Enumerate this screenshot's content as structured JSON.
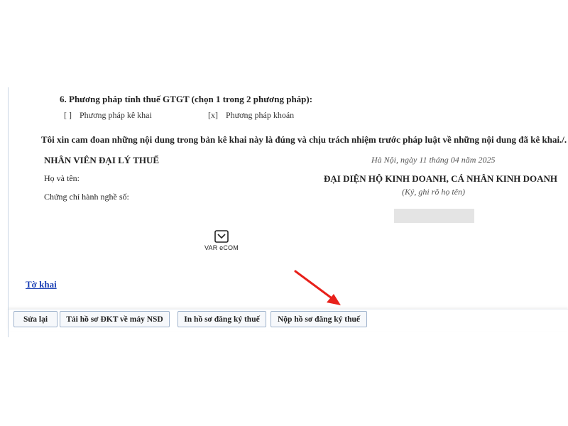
{
  "section": {
    "title": "6. Phương pháp tính thuế GTGT (chọn 1 trong 2 phương pháp):",
    "options": [
      {
        "mark": "[ ]",
        "label": "Phương pháp kê khai"
      },
      {
        "mark": "[x]",
        "label": "Phương pháp khoán"
      }
    ]
  },
  "declaration": "Tôi xin cam đoan những nội dung trong bản kê khai này là đúng và chịu trách nhiệm trước pháp luật về những nội dung đã kê khai./.",
  "agent": {
    "title": "NHÂN VIÊN ĐẠI LÝ THUẾ",
    "name_label": "Họ và tên:",
    "cert_label": "Chứng chỉ hành nghề số:"
  },
  "representative": {
    "date_line": "Hà Nội, ngày 11 tháng 04 năm 2025",
    "title": "ĐẠI DIỆN HỘ KINH DOANH, CÁ NHÂN KINH DOANH",
    "sign_note": "(Ký, ghi rõ họ tên)"
  },
  "watermark": {
    "text": "VAR eCOM",
    "icon": "var-ecom-logo-icon"
  },
  "form_link": "Tờ khai",
  "toolbar": {
    "edit_label": "Sửa lại",
    "download_label": "Tải hồ sơ ĐKT về máy NSD",
    "print_label": "In hồ sơ đăng ký thuế",
    "submit_label": "Nộp hồ sơ đăng ký thuế"
  },
  "annotation": {
    "icon": "red-arrow-icon",
    "color": "#e8201a"
  },
  "colors": {
    "link": "#1a3fb5",
    "button_border": "#9fb3cc",
    "arrow": "#e8201a"
  }
}
